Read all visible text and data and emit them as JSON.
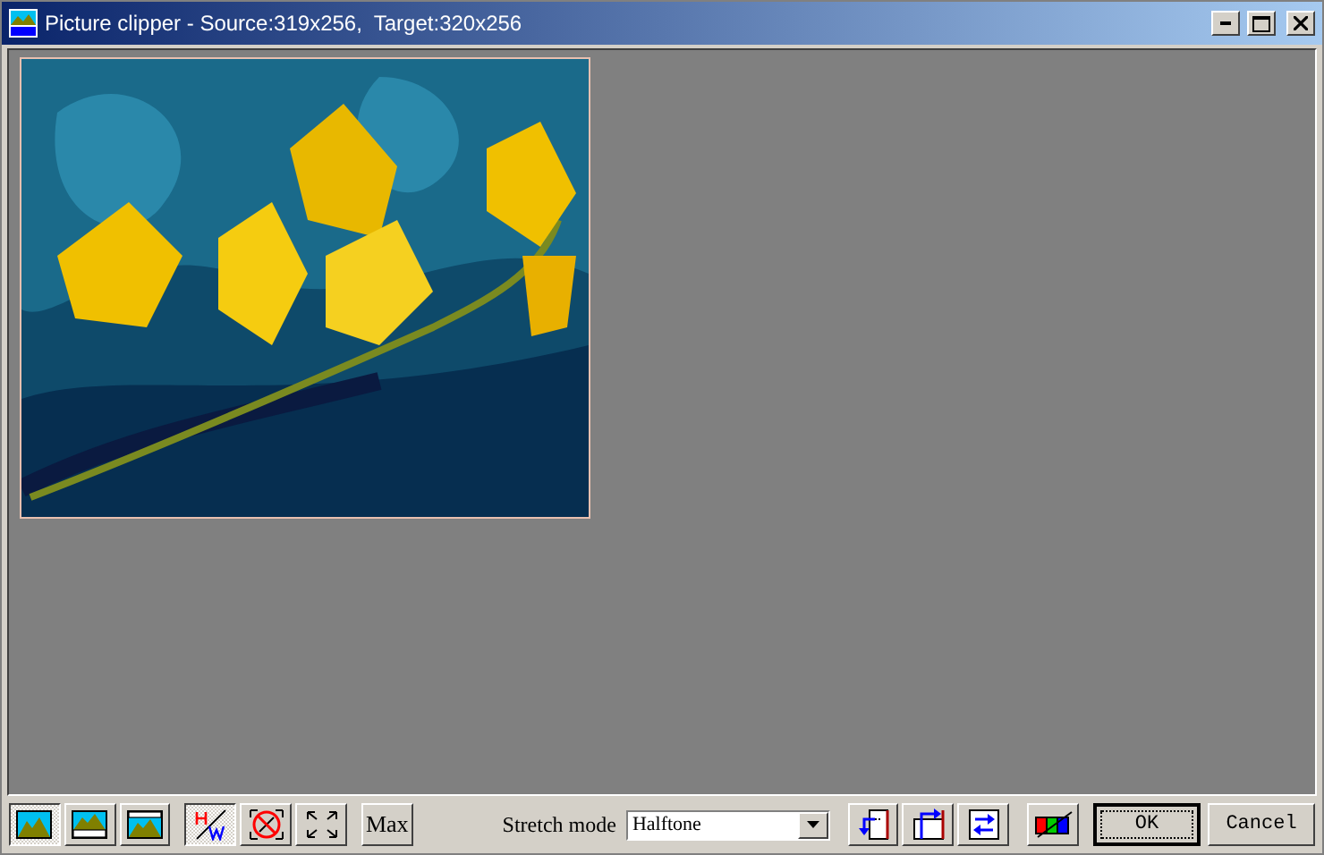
{
  "window": {
    "title": "Picture clipper - Source:319x256,  Target:320x256"
  },
  "toolbar": {
    "layout_buttons": [
      {
        "kind": "full",
        "selected": true
      },
      {
        "kind": "bottom",
        "selected": false
      },
      {
        "kind": "top",
        "selected": false
      }
    ],
    "mode_buttons": [
      {
        "kind": "aspect",
        "selected": true
      },
      {
        "kind": "nostretch",
        "selected": false
      },
      {
        "kind": "fit",
        "selected": false
      }
    ],
    "max_button": "Max",
    "stretch_mode": {
      "label": "Stretch mode",
      "value": "Halftone"
    },
    "action_buttons": [
      {
        "kind": "crop-left"
      },
      {
        "kind": "crop-top"
      },
      {
        "kind": "swap"
      },
      {
        "kind": "color"
      }
    ],
    "ok": "OK",
    "cancel": "Cancel"
  }
}
